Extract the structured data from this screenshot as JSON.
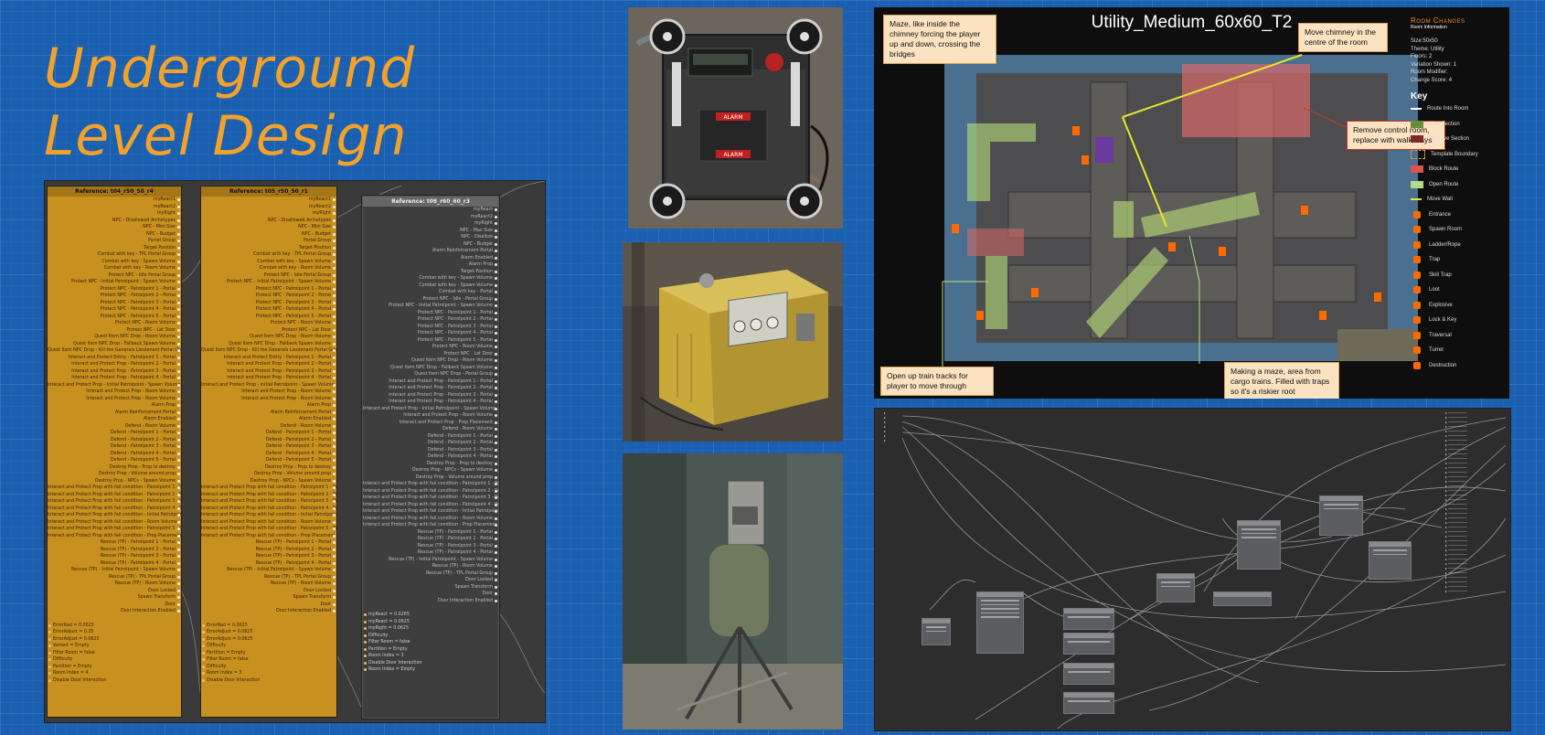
{
  "title": {
    "line1": "Underground",
    "line2": "Level Design"
  },
  "graph": {
    "nodes": [
      {
        "title": "Reference: t04_r50_50_r4"
      },
      {
        "title": "Reference: t05_r50_50_r1"
      },
      {
        "title": "Reference: t08_r60_60_r3"
      }
    ],
    "outputs_1": [
      "myReact1",
      "myReact2",
      "myRight",
      "NPC - Disallowed Archetypes",
      "NPC - Mini Size",
      "NPC - Budget",
      "Portal Group",
      "Target Position",
      "Combat with key - TPL Portal Group",
      "Combat with key - Spawn Volume",
      "Combat with key - Room Volume",
      "Protect NPC - Idle Portal Group",
      "Protect NPC - Initial Patrolpoint - Spawn Volume",
      "Protect NPC - Patrolpoint 1 - Portal",
      "Protect NPC - Patrolpoint 2 - Portal",
      "Protect NPC - Patrolpoint 3 - Portal",
      "Protect NPC - Patrolpoint 4 - Portal",
      "Protect NPC - Patrolpoint 5 - Portal",
      "Protect NPC - Room Volume",
      "Protect NPC - Lat Door",
      "Quest Item NPC Drop - Room Volume",
      "Quest Item NPC Drop - Fallback Spawn Volume",
      "Quest Item NPC Drop - Kill the Generals Lieutenant Portal Group",
      "Interact and Protect Entity - Patrolpoint 1 - Portal",
      "Interact and Protect Prop - Patrolpoint 2 - Portal",
      "Interact and Protect Prop - Patrolpoint 3 - Portal",
      "Interact and Protect Prop - Patrolpoint 4 - Portal",
      "Interact and Protect Prop - Initial Patrolpoint - Spawn Volume",
      "Interact and Protect Prop - Room Volume",
      "Interact and Protect Prop - Room Volume",
      "Alarm Prop",
      "Alarm Reinforcement Portal",
      "Alarm Enabled",
      "Defend - Room Volume",
      "Defend - Patrolpoint 1 - Portal",
      "Defend - Patrolpoint 2 - Portal",
      "Defend - Patrolpoint 3 - Portal",
      "Defend - Patrolpoint 4 - Portal",
      "Defend - Patrolpoint 5 - Portal",
      "Destroy Prop - Prop to destroy",
      "Destroy Prop - Volume around prop",
      "Destroy Prop - NPCs - Spawn Volume",
      "Interact and Protect Prop with fail condition - Patrolpoint 1 - Portal",
      "Interact and Protect Prop with fail condition - Patrolpoint 2 - Portal",
      "Interact and Protect Prop with fail condition - Patrolpoint 3 - Portal",
      "Interact and Protect Prop with fail condition - Patrolpoint 4 - Portal",
      "Interact and Protect Prop with fail condition - Initial Patrolpoint - Spawn Volume",
      "Interact and Protect Prop with fail condition - Room Volume",
      "Interact and Protect Prop with fail condition - Patrolpoint 5 - Portal",
      "Interact and Protect Prop with fail condition - Prop Placement",
      "Rescue (TP) - Patrolpoint 1 - Portal",
      "Rescue (TP) - Patrolpoint 2 - Portal",
      "Rescue (TP) - Patrolpoint 3 - Portal",
      "Rescue (TP) - Patrolpoint 4 - Portal",
      "Rescue (TP) - Initial Patrolpoint - Spawn Volume",
      "Rescue (TP) - TPL Portal Group",
      "Rescue (TP) - Room Volume",
      "Door Locked",
      "Spawn Transform",
      "Door",
      "Door Interaction Enabled"
    ],
    "outputs_3": [
      "myReact",
      "myReact2",
      "myRight",
      "NPC - Max Size",
      "NPC - Disallow",
      "NPC - Budget",
      "Alarm Reinforcement Portal",
      "Alarm Enabled",
      "Alarm Prop",
      "Target Position",
      "Combat with key - Spawn Volume",
      "Combat with key - Spawn Volume",
      "Combat with key - Portal",
      "Protect NPC - Idle - Portal Group",
      "Protect NPC - Initial Patrolpoint - Spawn Volume",
      "Protect NPC - Patrolpoint 1 - Portal",
      "Protect NPC - Patrolpoint 2 - Portal",
      "Protect NPC - Patrolpoint 3 - Portal",
      "Protect NPC - Patrolpoint 4 - Portal",
      "Protect NPC - Patrolpoint 5 - Portal",
      "Protect NPC - Room Volume",
      "Protect NPC - Lat Door",
      "Quest Item NPC Drop - Room Volume",
      "Quest Item NPC Drop - Fallback Spawn Volume",
      "Quest Item NPC Drop - Portal Group",
      "Interact and Protect Prop - Patrolpoint 1 - Portal",
      "Interact and Protect Prop - Patrolpoint 2 - Portal",
      "Interact and Protect Prop - Patrolpoint 3 - Portal",
      "Interact and Protect Prop - Patrolpoint 4 - Portal",
      "Interact and Protect Prop - Initial Patrolpoint - Spawn Volume",
      "Interact and Protect Prop - Room Volume",
      "Interact and Protect Prop - Prop Placement",
      "Defend - Room Volume",
      "Defend - Patrolpoint 1 - Portal",
      "Defend - Patrolpoint 2 - Portal",
      "Defend - Patrolpoint 3 - Portal",
      "Defend - Patrolpoint 4 - Portal",
      "Destroy Prop - Prop to destroy",
      "Destroy Prop - NPCs - Spawn Volume",
      "Destroy Prop - Volume around prop",
      "Interact and Protect Prop with fail condition - Patrolpoint 1 - Portal",
      "Interact and Protect Prop with fail condition - Patrolpoint 2 - Portal",
      "Interact and Protect Prop with fail condition - Patrolpoint 3 - Portal",
      "Interact and Protect Prop with fail condition - Patrolpoint 4 - Portal",
      "Interact and Protect Prop with fail condition - Initial Patrolpoint - Spawn Volume",
      "Interact and Protect Prop with fail condition - Room Volume",
      "Interact and Protect Prop with fail condition - Prop Placement",
      "Rescue (TP) - Patrolpoint 1 - Portal",
      "Rescue (TP) - Patrolpoint 2 - Portal",
      "Rescue (TP) - Patrolpoint 3 - Portal",
      "Rescue (TP) - Patrolpoint 4 - Portal",
      "Rescue (TP) - Initial Patrolpoint - Spawn Volume",
      "Rescue (TP) - Room Volume",
      "Rescue (TP) - TPL Portal Group",
      "Door Locked",
      "Spawn Transform",
      "Door",
      "Door Interaction Enabled"
    ],
    "inputs_1": [
      "ErrorRad = 0.0625",
      "ErrorAdjust = 0.35",
      "ErrorAdjust = 0.0625",
      "Variant = Empty",
      "Filter Room = false",
      "Difficulty",
      "Partition = Empty",
      "Room Index = 4",
      "Disable Door Interaction"
    ],
    "inputs_2": [
      "ErrorRad = 0.0625",
      "ErrorAdjust = 0.0625",
      "ErrorAdjust = 0.0625",
      "Difficulty",
      "Partition = Empty",
      "Filter Room = false",
      "Difficulty",
      "Room Index = 3",
      "Disable Door Interaction"
    ],
    "inputs_3": [
      "myReact = 0.0265",
      "myReact = 0.0625",
      "myRight = 0.0625",
      "Difficulty",
      "Filter Room = false",
      "Partition = Empty",
      "Room Index = 3",
      "Disable Door Interaction",
      "Room Index = Empty"
    ]
  },
  "map": {
    "title": "Utility_Medium_60x60_T2",
    "notes": {
      "chimney": "Maze, like inside the chimney forcing the player up and down, crossing the bridges",
      "move_chimney": "Move chimney in the centre of the room",
      "remove_control": "Remove control room, replace with walk ways",
      "train_tracks": "Open up train tracks for player to move through",
      "maze_cargo": "Making a maze, area from cargo trains. Filled with traps so it's a riskier root"
    },
    "panel": {
      "heading": "Room Changes",
      "subheading": "Room Information",
      "info": [
        "Size:50x50",
        "Theme: Utility",
        "Floors: 2",
        "Variation Shown: 1",
        "Room Modifier:",
        "Change Score: 4"
      ],
      "key_title": "Key",
      "key": [
        {
          "label": "Route Into Room",
          "color": "#ffffff"
        },
        {
          "label": "New Section",
          "color": "#6b8a3a"
        },
        {
          "label": "Remove Section",
          "color": "#7a2a2a"
        },
        {
          "label": "Template Boundary",
          "color": "#c9a050"
        },
        {
          "label": "Block Route",
          "color": "#e05050"
        },
        {
          "label": "Open Route",
          "color": "#b7d98a"
        },
        {
          "label": "Move Wall",
          "color": "#e6e62a"
        },
        {
          "label": "Entrance",
          "color": "#ff6a00"
        },
        {
          "label": "Spawn Room",
          "color": "#ff6a00"
        },
        {
          "label": "Ladder/Rope",
          "color": "#ff6a00"
        },
        {
          "label": "Trap",
          "color": "#ff6a00"
        },
        {
          "label": "Skill Trap",
          "color": "#ff6a00"
        },
        {
          "label": "Loot",
          "color": "#ff6a00"
        },
        {
          "label": "Explosive",
          "color": "#ff6a00"
        },
        {
          "label": "Lock & Key",
          "color": "#ff6a00"
        },
        {
          "label": "Traversal",
          "color": "#ff6a00"
        },
        {
          "label": "Turret",
          "color": "#ff6a00"
        },
        {
          "label": "Destruction",
          "color": "#ff6a00"
        }
      ]
    }
  },
  "photos": {
    "alarm_label": "ALARM"
  }
}
